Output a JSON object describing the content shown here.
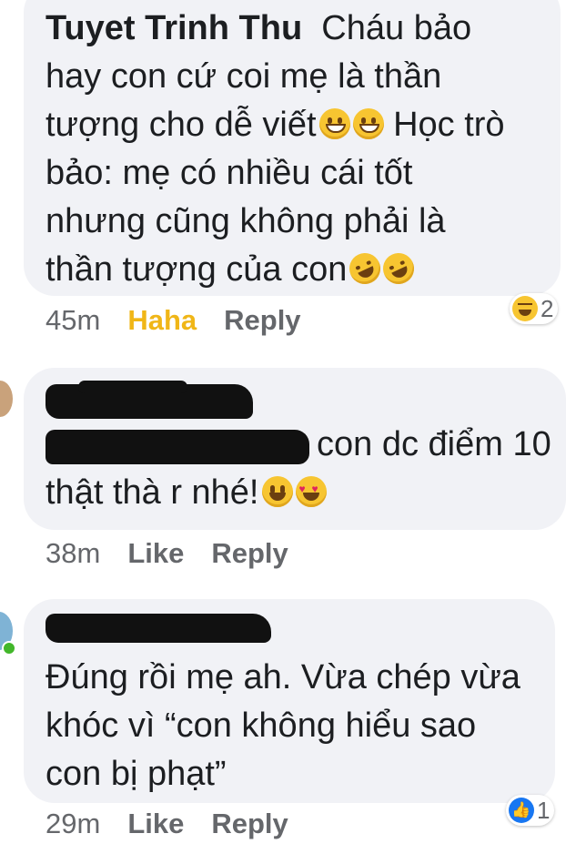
{
  "comments": [
    {
      "author": "Tuyet Trinh Thu",
      "text_lines": [
        "Cháu bảo",
        "hay con cứ coi mẹ là thần",
        "tượng cho dễ viết",
        " Học trò",
        "bảo: mẹ có nhiều cái tốt",
        "nhưng cũng không phải là",
        "thần tượng của con"
      ],
      "time": "45m",
      "reaction_action": "Haha",
      "reply": "Reply",
      "reaction_count": "2",
      "reaction_icon": "haha-icon"
    },
    {
      "author": "",
      "text_lines": [
        "con dc điểm 10",
        "thật thà r nhé!"
      ],
      "time": "38m",
      "reaction_action": "Like",
      "reply": "Reply"
    },
    {
      "author": "",
      "text_lines": [
        "Đúng rồi mẹ ah. Vừa chép vừa",
        "khóc vì “con không hiểu sao",
        "con bị phạt”"
      ],
      "time": "29m",
      "reaction_action": "Like",
      "reply": "Reply",
      "reaction_count": "1",
      "reaction_icon": "like-icon"
    }
  ],
  "colors": {
    "bubble": "#f1f2f6",
    "haha_active": "#f0b617",
    "meta_text": "#65676b",
    "like_blue": "#1877f2"
  }
}
